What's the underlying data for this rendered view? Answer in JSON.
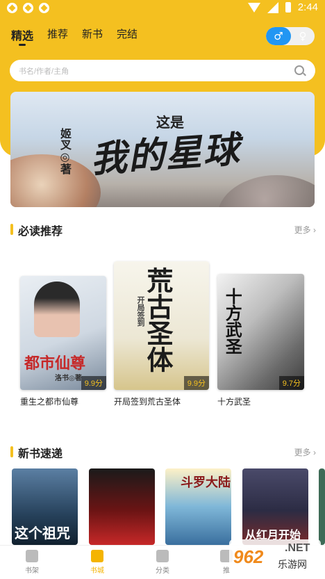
{
  "status_bar": {
    "time": "2:44"
  },
  "top_tabs": [
    {
      "label": "精选",
      "active": true
    },
    {
      "label": "推荐",
      "active": false
    },
    {
      "label": "新书",
      "active": false
    },
    {
      "label": "完结",
      "active": false
    }
  ],
  "gender_toggle": {
    "male": "♂",
    "female": "♀"
  },
  "search": {
    "placeholder": "书名/作者/主角"
  },
  "banner": {
    "subtitle": "这是",
    "title": "我的星球",
    "author": "姬叉◎著"
  },
  "must_read": {
    "title": "必读推荐",
    "more": "更多 ›",
    "books": [
      {
        "title": "重生之都市仙尊",
        "score": "9.9分",
        "cover_text": "都市仙尊",
        "cover_author": "洛书◎著"
      },
      {
        "title": "开局签到荒古圣体",
        "score": "9.9分",
        "cover_text": "荒古圣体",
        "cover_side": "开局签到"
      },
      {
        "title": "十方武圣",
        "score": "9.7分",
        "cover_text": "十方武圣"
      }
    ]
  },
  "new_books": {
    "title": "新书速递",
    "more": "更多 ›",
    "covers": [
      {
        "text": "这个祖咒"
      },
      {
        "text": ""
      },
      {
        "text": "斗罗大陆"
      },
      {
        "text": "从红月开始"
      }
    ]
  },
  "bottom_nav": [
    {
      "label": "书架",
      "active": false
    },
    {
      "label": "书城",
      "active": true
    },
    {
      "label": "分类",
      "active": false
    },
    {
      "label": "推",
      "active": false
    }
  ],
  "watermark": {
    "logo": "962",
    "net": ".NET",
    "sub": "乐游网"
  },
  "colors": {
    "accent": "#f4c020",
    "male": "#2196f3",
    "score": "#f4c020"
  }
}
